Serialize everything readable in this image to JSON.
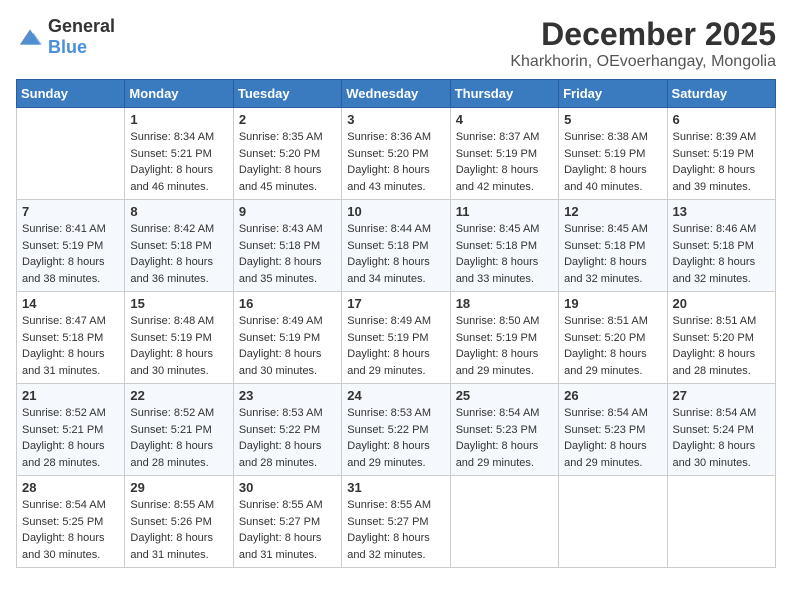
{
  "logo": {
    "text_general": "General",
    "text_blue": "Blue"
  },
  "title": "December 2025",
  "location": "Kharkhorin, OEvoerhangay, Mongolia",
  "weekdays": [
    "Sunday",
    "Monday",
    "Tuesday",
    "Wednesday",
    "Thursday",
    "Friday",
    "Saturday"
  ],
  "weeks": [
    [
      {
        "day": "",
        "sunrise": "",
        "sunset": "",
        "daylight": ""
      },
      {
        "day": "1",
        "sunrise": "Sunrise: 8:34 AM",
        "sunset": "Sunset: 5:21 PM",
        "daylight": "Daylight: 8 hours and 46 minutes."
      },
      {
        "day": "2",
        "sunrise": "Sunrise: 8:35 AM",
        "sunset": "Sunset: 5:20 PM",
        "daylight": "Daylight: 8 hours and 45 minutes."
      },
      {
        "day": "3",
        "sunrise": "Sunrise: 8:36 AM",
        "sunset": "Sunset: 5:20 PM",
        "daylight": "Daylight: 8 hours and 43 minutes."
      },
      {
        "day": "4",
        "sunrise": "Sunrise: 8:37 AM",
        "sunset": "Sunset: 5:19 PM",
        "daylight": "Daylight: 8 hours and 42 minutes."
      },
      {
        "day": "5",
        "sunrise": "Sunrise: 8:38 AM",
        "sunset": "Sunset: 5:19 PM",
        "daylight": "Daylight: 8 hours and 40 minutes."
      },
      {
        "day": "6",
        "sunrise": "Sunrise: 8:39 AM",
        "sunset": "Sunset: 5:19 PM",
        "daylight": "Daylight: 8 hours and 39 minutes."
      }
    ],
    [
      {
        "day": "7",
        "sunrise": "Sunrise: 8:41 AM",
        "sunset": "Sunset: 5:19 PM",
        "daylight": "Daylight: 8 hours and 38 minutes."
      },
      {
        "day": "8",
        "sunrise": "Sunrise: 8:42 AM",
        "sunset": "Sunset: 5:18 PM",
        "daylight": "Daylight: 8 hours and 36 minutes."
      },
      {
        "day": "9",
        "sunrise": "Sunrise: 8:43 AM",
        "sunset": "Sunset: 5:18 PM",
        "daylight": "Daylight: 8 hours and 35 minutes."
      },
      {
        "day": "10",
        "sunrise": "Sunrise: 8:44 AM",
        "sunset": "Sunset: 5:18 PM",
        "daylight": "Daylight: 8 hours and 34 minutes."
      },
      {
        "day": "11",
        "sunrise": "Sunrise: 8:45 AM",
        "sunset": "Sunset: 5:18 PM",
        "daylight": "Daylight: 8 hours and 33 minutes."
      },
      {
        "day": "12",
        "sunrise": "Sunrise: 8:45 AM",
        "sunset": "Sunset: 5:18 PM",
        "daylight": "Daylight: 8 hours and 32 minutes."
      },
      {
        "day": "13",
        "sunrise": "Sunrise: 8:46 AM",
        "sunset": "Sunset: 5:18 PM",
        "daylight": "Daylight: 8 hours and 32 minutes."
      }
    ],
    [
      {
        "day": "14",
        "sunrise": "Sunrise: 8:47 AM",
        "sunset": "Sunset: 5:18 PM",
        "daylight": "Daylight: 8 hours and 31 minutes."
      },
      {
        "day": "15",
        "sunrise": "Sunrise: 8:48 AM",
        "sunset": "Sunset: 5:19 PM",
        "daylight": "Daylight: 8 hours and 30 minutes."
      },
      {
        "day": "16",
        "sunrise": "Sunrise: 8:49 AM",
        "sunset": "Sunset: 5:19 PM",
        "daylight": "Daylight: 8 hours and 30 minutes."
      },
      {
        "day": "17",
        "sunrise": "Sunrise: 8:49 AM",
        "sunset": "Sunset: 5:19 PM",
        "daylight": "Daylight: 8 hours and 29 minutes."
      },
      {
        "day": "18",
        "sunrise": "Sunrise: 8:50 AM",
        "sunset": "Sunset: 5:19 PM",
        "daylight": "Daylight: 8 hours and 29 minutes."
      },
      {
        "day": "19",
        "sunrise": "Sunrise: 8:51 AM",
        "sunset": "Sunset: 5:20 PM",
        "daylight": "Daylight: 8 hours and 29 minutes."
      },
      {
        "day": "20",
        "sunrise": "Sunrise: 8:51 AM",
        "sunset": "Sunset: 5:20 PM",
        "daylight": "Daylight: 8 hours and 28 minutes."
      }
    ],
    [
      {
        "day": "21",
        "sunrise": "Sunrise: 8:52 AM",
        "sunset": "Sunset: 5:21 PM",
        "daylight": "Daylight: 8 hours and 28 minutes."
      },
      {
        "day": "22",
        "sunrise": "Sunrise: 8:52 AM",
        "sunset": "Sunset: 5:21 PM",
        "daylight": "Daylight: 8 hours and 28 minutes."
      },
      {
        "day": "23",
        "sunrise": "Sunrise: 8:53 AM",
        "sunset": "Sunset: 5:22 PM",
        "daylight": "Daylight: 8 hours and 28 minutes."
      },
      {
        "day": "24",
        "sunrise": "Sunrise: 8:53 AM",
        "sunset": "Sunset: 5:22 PM",
        "daylight": "Daylight: 8 hours and 29 minutes."
      },
      {
        "day": "25",
        "sunrise": "Sunrise: 8:54 AM",
        "sunset": "Sunset: 5:23 PM",
        "daylight": "Daylight: 8 hours and 29 minutes."
      },
      {
        "day": "26",
        "sunrise": "Sunrise: 8:54 AM",
        "sunset": "Sunset: 5:23 PM",
        "daylight": "Daylight: 8 hours and 29 minutes."
      },
      {
        "day": "27",
        "sunrise": "Sunrise: 8:54 AM",
        "sunset": "Sunset: 5:24 PM",
        "daylight": "Daylight: 8 hours and 30 minutes."
      }
    ],
    [
      {
        "day": "28",
        "sunrise": "Sunrise: 8:54 AM",
        "sunset": "Sunset: 5:25 PM",
        "daylight": "Daylight: 8 hours and 30 minutes."
      },
      {
        "day": "29",
        "sunrise": "Sunrise: 8:55 AM",
        "sunset": "Sunset: 5:26 PM",
        "daylight": "Daylight: 8 hours and 31 minutes."
      },
      {
        "day": "30",
        "sunrise": "Sunrise: 8:55 AM",
        "sunset": "Sunset: 5:27 PM",
        "daylight": "Daylight: 8 hours and 31 minutes."
      },
      {
        "day": "31",
        "sunrise": "Sunrise: 8:55 AM",
        "sunset": "Sunset: 5:27 PM",
        "daylight": "Daylight: 8 hours and 32 minutes."
      },
      {
        "day": "",
        "sunrise": "",
        "sunset": "",
        "daylight": ""
      },
      {
        "day": "",
        "sunrise": "",
        "sunset": "",
        "daylight": ""
      },
      {
        "day": "",
        "sunrise": "",
        "sunset": "",
        "daylight": ""
      }
    ]
  ]
}
